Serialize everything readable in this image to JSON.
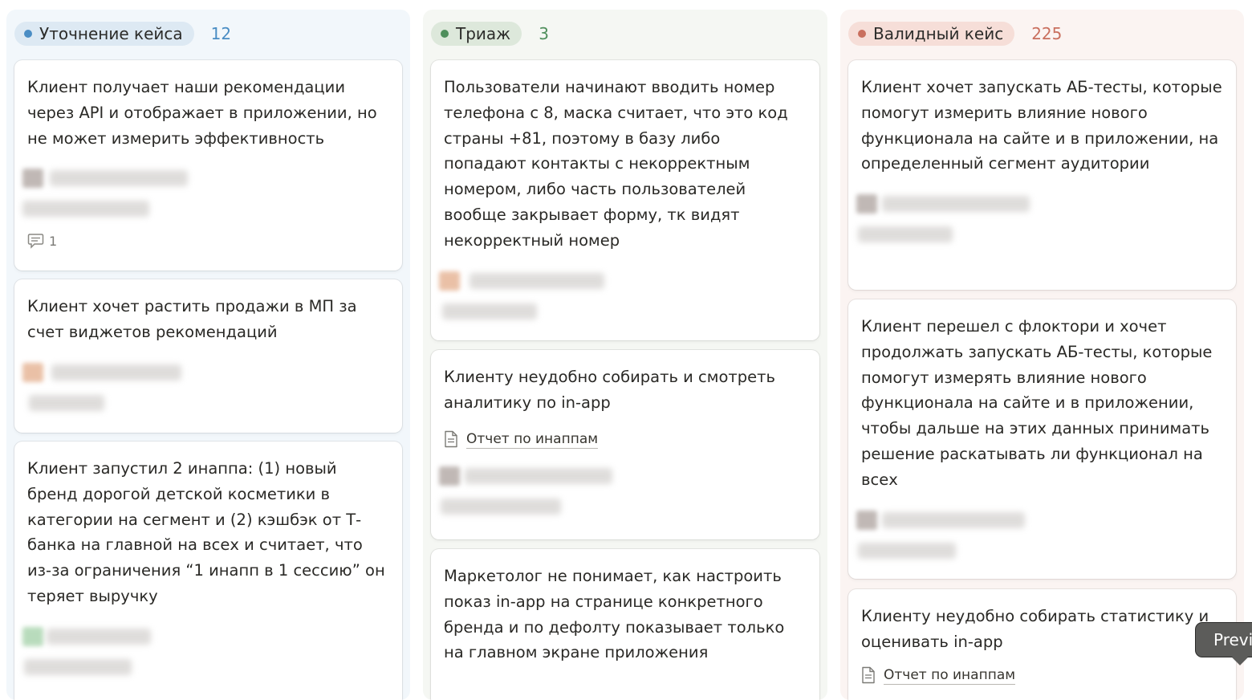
{
  "columns": [
    {
      "title": "Уточнение кейса",
      "count": "12",
      "cards": [
        {
          "title": "Клиент получает наши рекомендации через API и отображает в приложении, но не может измерить эффективность",
          "comments": "1"
        },
        {
          "title": "Клиент хочет растить продажи в МП за счет виджетов рекомендаций"
        },
        {
          "title": "Клиент запустил 2 инаппа: (1) новый бренд дорогой детской косметики в категории на сегмент и (2) кэшбэк от Т-банка на главной на всех и считает, что из-за ограничения “1 инапп в 1 сессию” он теряет выручку"
        }
      ]
    },
    {
      "title": "Триаж",
      "count": "3",
      "cards": [
        {
          "title": "Пользователи начинают вводить номер телефона с 8, маска считает, что это код страны +81, поэтому в базу либо попадают контакты с некорректным номером, либо часть пользователей вообще закрывает форму, тк видят некорректный номер"
        },
        {
          "title": "Клиенту неудобно собирать и смотреть аналитику по in-app",
          "doc": "Отчет по инаппам"
        },
        {
          "title": "Маркетолог не понимает, как настроить показ in-app на странице конкретного бренда и по дефолту показывает только на главном экране приложения"
        }
      ]
    },
    {
      "title": "Валидный кейс",
      "count": "225",
      "cards": [
        {
          "title": "Клиент хочет запускать АБ-тесты, которые помогут измерить влияние нового функционала на сайте и в приложении, на определенный сегмент аудитории"
        },
        {
          "title": "Клиент перешел с флоктори и хочет продолжать запускать АБ-тесты, которые помогут измерять влияние нового функционала на сайте и в приложении, чтобы дальше на этих данных принимать решение раскатывать ли функционал на всех"
        },
        {
          "title": "Клиенту неудобно собирать статистику и оценивать  in-app",
          "doc": "Отчет по инаппам"
        }
      ]
    }
  ],
  "tooltip": {
    "label": "Previ"
  },
  "colors": {
    "blue": "#4a8dc4",
    "green": "#4f8f5c",
    "red": "#c96f5e"
  }
}
